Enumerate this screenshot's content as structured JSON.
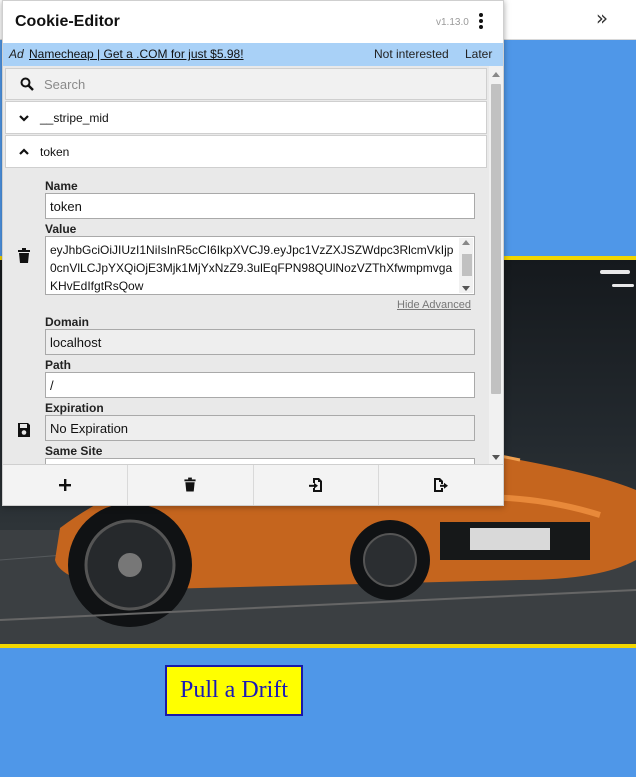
{
  "page": {
    "expand_icon": "double-chevron-right-icon",
    "button_label": "Pull a Drift",
    "colors": {
      "background": "#4f97e8",
      "stripe": "#f2d600",
      "button_bg": "#ffff00",
      "button_text": "#1a1ab8"
    }
  },
  "popup": {
    "title": "Cookie-Editor",
    "version": "v1.13.0",
    "menu_icon": "kebab-menu-icon",
    "ad": {
      "tag": "Ad",
      "link_text": "Namecheap | Get a .COM for just $5.98!",
      "dismiss_label": "Not interested",
      "later_label": "Later",
      "bg_color": "#a9d1f7"
    },
    "search": {
      "placeholder": "Search",
      "value": ""
    },
    "cookies": [
      {
        "name": "__stripe_mid",
        "expanded": false,
        "icon": "chevron-down-icon"
      },
      {
        "name": "token",
        "expanded": true,
        "icon": "chevron-up-icon"
      }
    ],
    "details": {
      "name_label": "Name",
      "name_value": "token",
      "value_label": "Value",
      "value_text": "eyJhbGciOiJIUzI1NiIsInR5cCI6IkpXVCJ9.eyJpc1VzZXJSZWdpc3RlcmVkIjp0cnVlLCJpYXQiOjE3Mjk1MjYxNzZ9.3ulEqFPN98QUlNozVZThXfwmpmvgaKHvEdIfgtRsQow",
      "hide_advanced": "Hide Advanced",
      "domain_label": "Domain",
      "domain_value": "localhost",
      "path_label": "Path",
      "path_value": "/",
      "expiration_label": "Expiration",
      "expiration_value": "No Expiration",
      "samesite_label": "Same Site",
      "delete_icon": "trash-icon",
      "save_icon": "floppy-disk-icon"
    },
    "footer": [
      {
        "name": "add-cookie-button",
        "icon": "plus-icon"
      },
      {
        "name": "delete-all-button",
        "icon": "trash-icon"
      },
      {
        "name": "import-button",
        "icon": "file-import-icon"
      },
      {
        "name": "export-button",
        "icon": "file-export-icon"
      }
    ]
  }
}
